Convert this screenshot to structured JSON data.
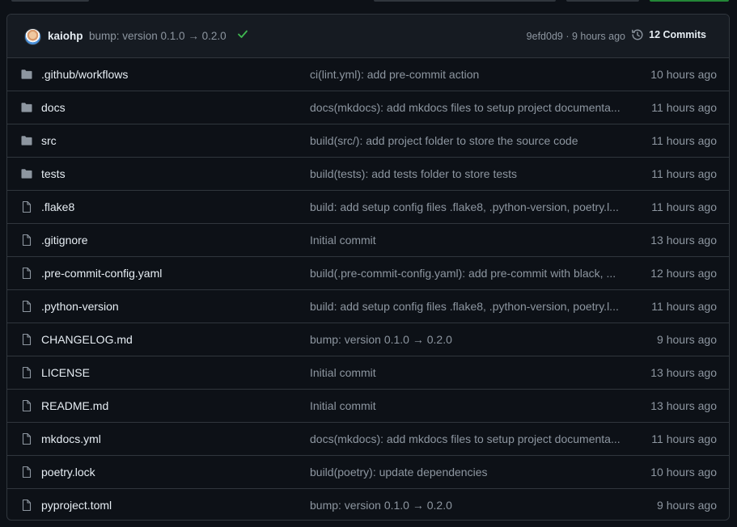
{
  "commit": {
    "author": "kaiohp",
    "message": "bump: version 0.1.0 → 0.2.0",
    "sha_time": "9efd0d9 · 9 hours ago",
    "commits_label": "12 Commits",
    "status_color": "#3fb950"
  },
  "files": [
    {
      "type": "folder",
      "name": ".github/workflows",
      "message": "ci(lint.yml): add pre-commit action",
      "age": "10 hours ago"
    },
    {
      "type": "folder",
      "name": "docs",
      "message": "docs(mkdocs): add mkdocs files to setup project documenta...",
      "age": "11 hours ago"
    },
    {
      "type": "folder",
      "name": "src",
      "message": "build(src/): add project folder to store the source code",
      "age": "11 hours ago"
    },
    {
      "type": "folder",
      "name": "tests",
      "message": "build(tests): add tests folder to store tests",
      "age": "11 hours ago"
    },
    {
      "type": "file",
      "name": ".flake8",
      "message": "build: add setup config files .flake8, .python-version, poetry.l...",
      "age": "11 hours ago"
    },
    {
      "type": "file",
      "name": ".gitignore",
      "message": "Initial commit",
      "age": "13 hours ago"
    },
    {
      "type": "file",
      "name": ".pre-commit-config.yaml",
      "message": "build(.pre-commit-config.yaml): add pre-commit with black, ...",
      "age": "12 hours ago"
    },
    {
      "type": "file",
      "name": ".python-version",
      "message": "build: add setup config files .flake8, .python-version, poetry.l...",
      "age": "11 hours ago"
    },
    {
      "type": "file",
      "name": "CHANGELOG.md",
      "message": "bump: version 0.1.0 → 0.2.0",
      "age": "9 hours ago"
    },
    {
      "type": "file",
      "name": "LICENSE",
      "message": "Initial commit",
      "age": "13 hours ago"
    },
    {
      "type": "file",
      "name": "README.md",
      "message": "Initial commit",
      "age": "13 hours ago"
    },
    {
      "type": "file",
      "name": "mkdocs.yml",
      "message": "docs(mkdocs): add mkdocs files to setup project documenta...",
      "age": "11 hours ago"
    },
    {
      "type": "file",
      "name": "poetry.lock",
      "message": "build(poetry): update dependencies",
      "age": "10 hours ago"
    },
    {
      "type": "file",
      "name": "pyproject.toml",
      "message": "bump: version 0.1.0 → 0.2.0",
      "age": "9 hours ago"
    }
  ]
}
